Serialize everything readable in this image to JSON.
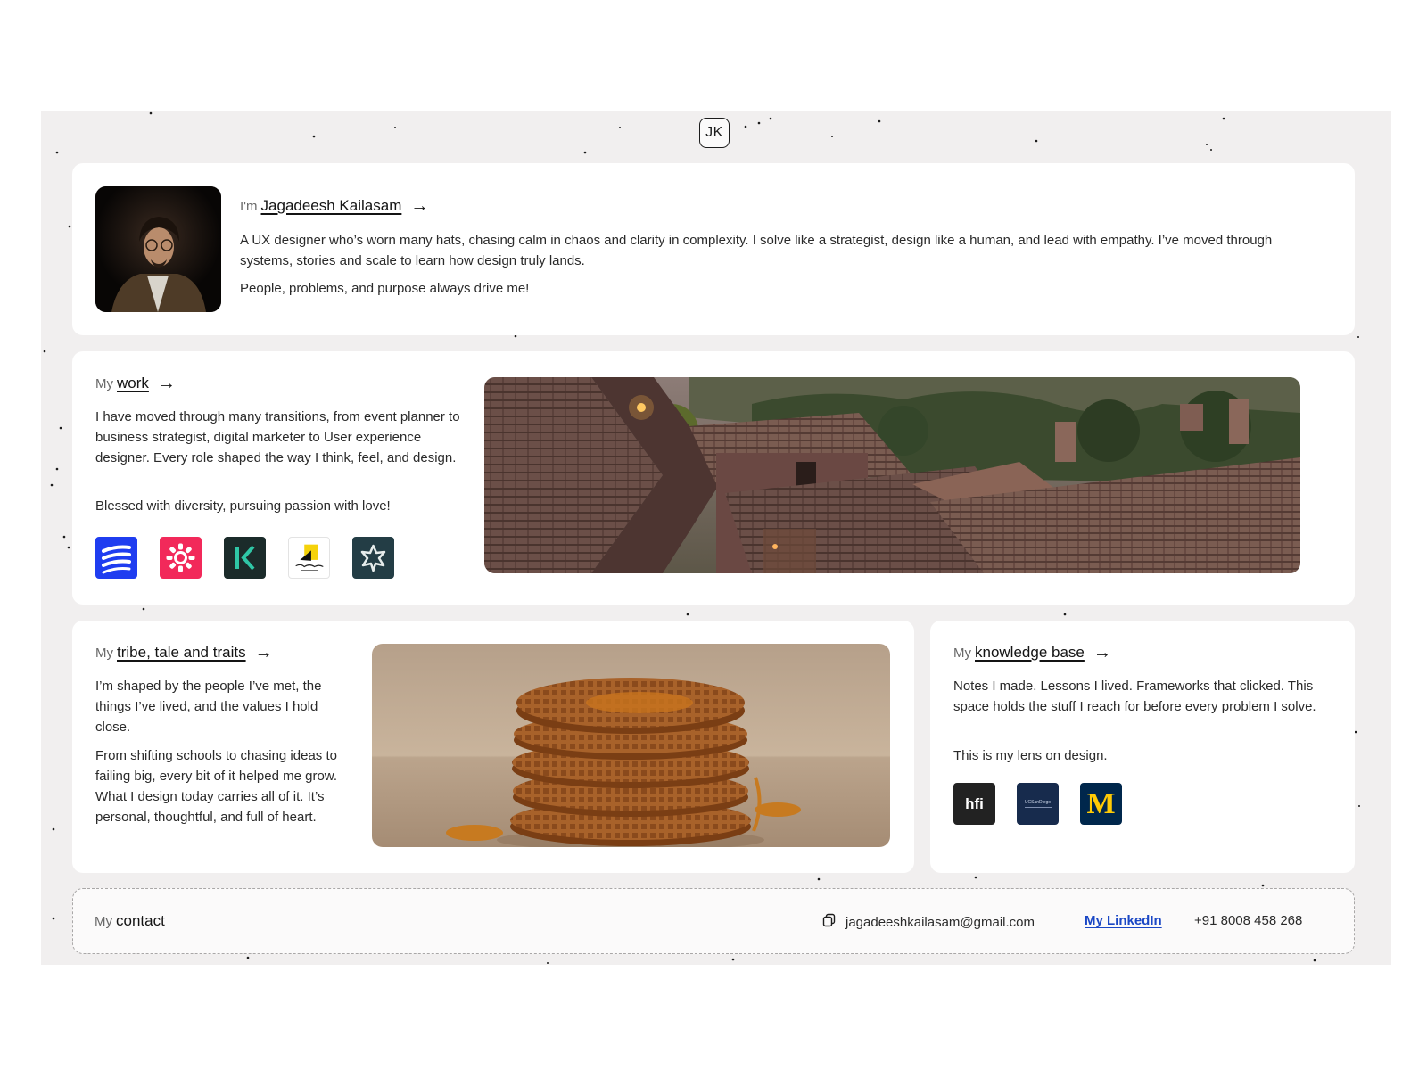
{
  "header": {
    "logo_text": "JK"
  },
  "intro": {
    "prefix": "I'm",
    "name": "Jagadeesh Kailasam",
    "arrow": "→",
    "bio": "A UX designer who’s worn many hats, chasing calm in chaos and clarity in complexity. I solve like a strategist, design like a human, and lead with empathy. I’ve moved through systems, stories and scale to learn how design truly lands.",
    "tagline": "People, problems, and purpose always drive me!"
  },
  "work": {
    "prefix": "My",
    "title": "work",
    "arrow": "→",
    "body": "I have moved through many transitions, from event planner to business strategist, digital marketer to User experience designer. Every role shaped the way I think, feel, and design.",
    "tagline": "Blessed with diversity, pursuing passion with love!",
    "logos": [
      {
        "icon": "stacked-lines-icon",
        "bg": "#1f3df0"
      },
      {
        "icon": "sun-burst-icon",
        "bg": "#f2295a"
      },
      {
        "icon": "k-letter-icon",
        "bg": "#1b2b2a"
      },
      {
        "icon": "yellow-book-icon",
        "bg": "#ffffff"
      },
      {
        "icon": "flower-icon",
        "bg": "#233d45"
      }
    ]
  },
  "tribe": {
    "prefix": "My",
    "title": "tribe, tale and traits",
    "arrow": "→",
    "body1": "I’m shaped by the people I’ve met, the things I’ve lived, and the values I hold close.",
    "body2": "From shifting schools to chasing ideas to failing big, every bit of it helped me grow. What I design today carries all of it. It’s personal, thoughtful, and full of heart."
  },
  "knowledge": {
    "prefix": "My",
    "title": "knowledge base",
    "arrow": "→",
    "body1": "Notes I made. Lessons I lived. Frameworks that clicked. This space holds the stuff I reach for before every problem I solve.",
    "body2": "This is my lens on design.",
    "logos": [
      {
        "label": "hfi",
        "bg": "#222222",
        "color": "#ffffff"
      },
      {
        "label": "UCSanDiego",
        "bg": "#172b4d",
        "color": "#c9d3e6"
      },
      {
        "label": "M",
        "bg": "#00274c",
        "color": "#ffcb05"
      }
    ]
  },
  "contact": {
    "prefix": "My",
    "title": "contact",
    "email": "jagadeeshkailasam@gmail.com",
    "linkedin": "My LinkedIn",
    "phone": "+91 8008 458 268"
  }
}
